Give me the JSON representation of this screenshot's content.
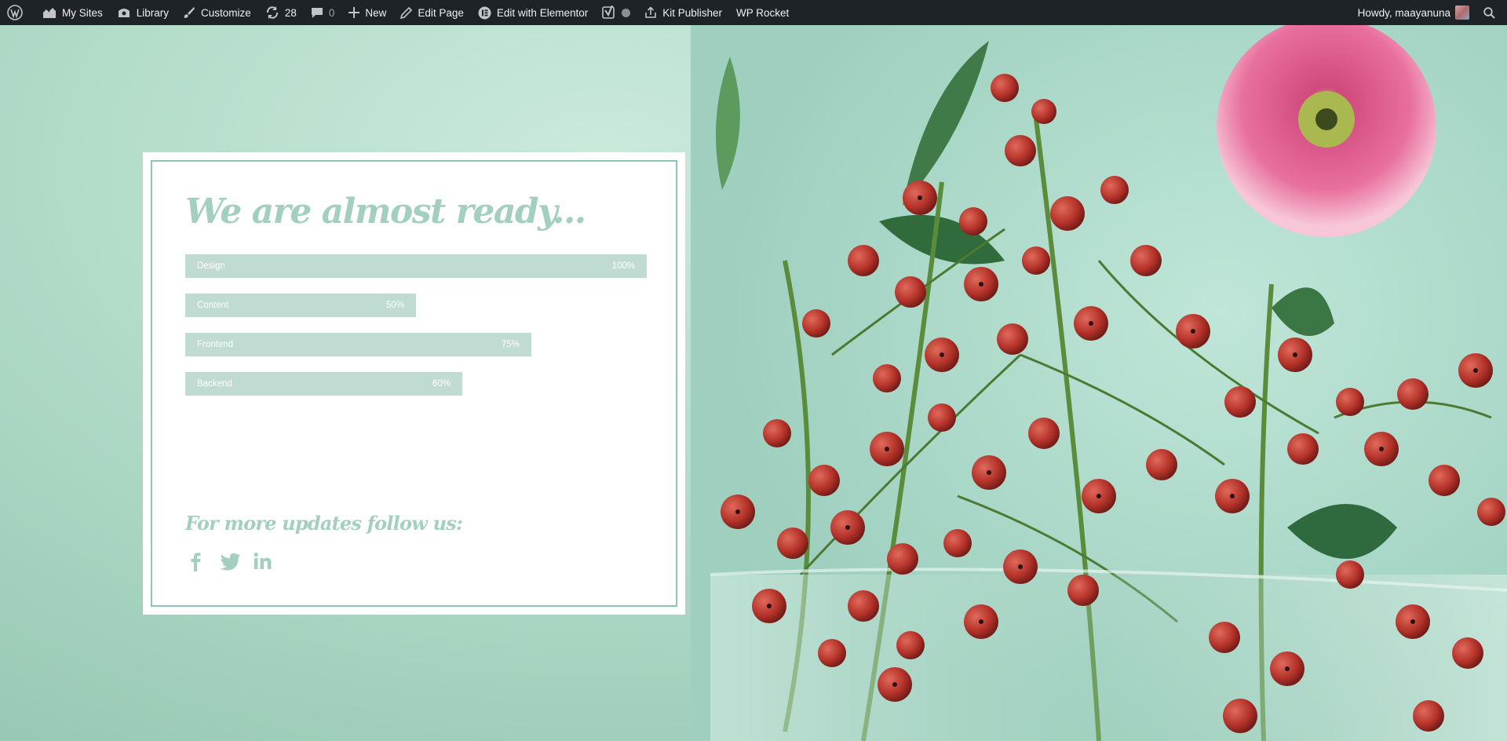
{
  "admin_bar": {
    "my_sites": "My Sites",
    "library": "Library",
    "customize": "Customize",
    "updates_count": "28",
    "comments_count": "0",
    "new": "New",
    "edit_page": "Edit Page",
    "edit_with_elementor": "Edit with Elementor",
    "kit_publisher": "Kit Publisher",
    "wp_rocket": "WP Rocket",
    "howdy": "Howdy, maayanuna"
  },
  "card": {
    "headline": "We are almost ready...",
    "progress": [
      {
        "label": "Design",
        "value_text": "100%",
        "value": 100
      },
      {
        "label": "Content",
        "value_text": "50%",
        "value": 50
      },
      {
        "label": "Frontend",
        "value_text": "75%",
        "value": 75
      },
      {
        "label": "Backend",
        "value_text": "60%",
        "value": 60
      }
    ],
    "follow_text": "For more updates follow us:",
    "social": [
      "facebook-icon",
      "twitter-icon",
      "linkedin-icon"
    ]
  },
  "colors": {
    "accent": "#a3cfc0",
    "bar": "#c0dcd2",
    "admin_bar": "#1d2327"
  }
}
